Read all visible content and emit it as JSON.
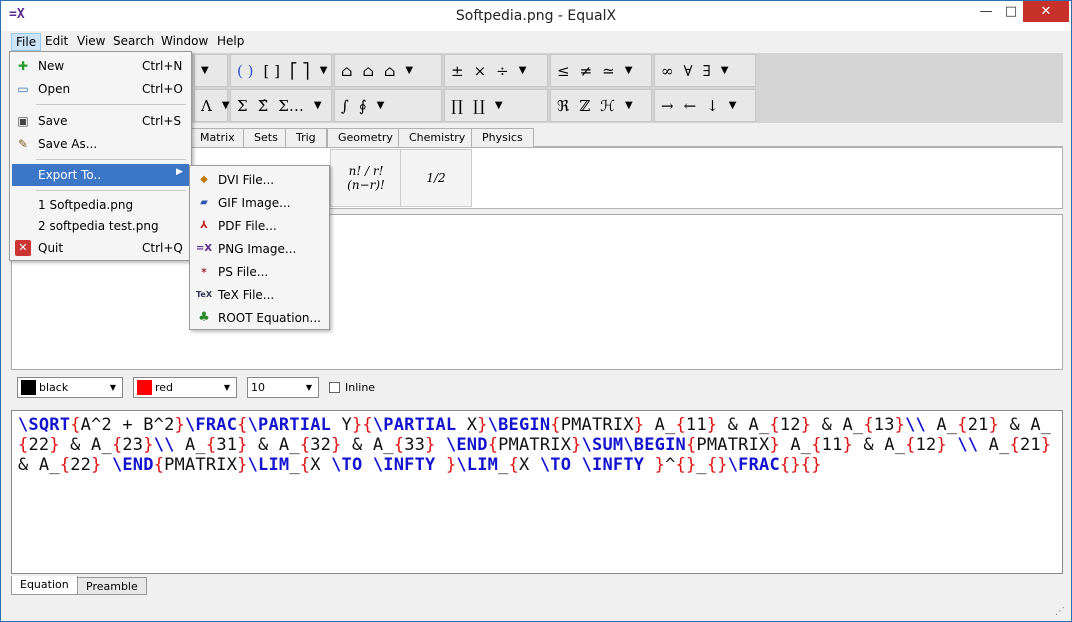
{
  "window": {
    "title": "Softpedia.png - EqualX",
    "app_icon": "=X"
  },
  "window_controls": {
    "minimize": "—",
    "maximize": "□",
    "close": "✕"
  },
  "menubar": [
    "File",
    "Edit",
    "View",
    "Search",
    "Window",
    "Help"
  ],
  "toolbar": {
    "row1": [
      [
        "( )",
        "[ ]",
        "⎡ ⎤"
      ],
      [
        "⌂",
        "⌂",
        "⌂"
      ],
      [
        "±",
        "×",
        "÷"
      ],
      [
        "≤",
        "≠",
        "≃"
      ],
      [
        "∞",
        "∀",
        "∃"
      ]
    ],
    "row2": [
      [
        "Λ"
      ],
      [
        "Σ",
        "Σ̂",
        "Σ…"
      ],
      [
        "∫",
        "∮"
      ],
      [
        "∏",
        "∐"
      ],
      [
        "ℜ",
        "ℤ",
        "ℋ"
      ],
      [
        "→",
        "←",
        "↓"
      ]
    ]
  },
  "tabs": [
    "Matrix",
    "Sets",
    "Trig",
    "Geometry",
    "Chemistry",
    "Physics"
  ],
  "palette": {
    "binomial": "n! / r!(n−r)!",
    "fraction": "1/2"
  },
  "options": {
    "text_color": "black",
    "text_color_hex": "#000000",
    "bg_color": "red",
    "bg_color_hex": "#ff0000",
    "font_size": "10",
    "inline_label": "Inline"
  },
  "editor": {
    "text": "\\SQRT{A^2 + B^2}\\FRAC{\\PARTIAL Y}{\\PARTIAL X}\\BEGIN{PMATRIX} A_{11} & A_{12} & A_{13}\\\\ A_{21} & A_{22} & A_{23}\\\\ A_{31} & A_{32} & A_{33} \\END{PMATRIX}\\SUM\\BEGIN{PMATRIX} A_{11} & A_{12} \\\\ A_{21} & A_{22} \\END{PMATRIX}\\LIM_{X \\TO \\INFTY }\\LIM_{X \\TO \\INFTY }^{}_{}\\FRAC{}{}"
  },
  "bottom_tabs": [
    "Equation",
    "Preamble"
  ],
  "file_menu": {
    "items": [
      {
        "label": "New",
        "shortcut": "Ctrl+N",
        "icon": "new-file-icon"
      },
      {
        "label": "Open",
        "shortcut": "Ctrl+O",
        "icon": "open-file-icon"
      },
      {
        "label": "Save",
        "shortcut": "Ctrl+S",
        "icon": "save-icon"
      },
      {
        "label": "Save As...",
        "shortcut": "",
        "icon": "save-as-icon"
      },
      {
        "label": "Export To..",
        "shortcut": "",
        "icon": ""
      },
      {
        "label": "1 Softpedia.png",
        "shortcut": "",
        "icon": ""
      },
      {
        "label": "2 softpedia test.png",
        "shortcut": "",
        "icon": ""
      },
      {
        "label": "Quit",
        "shortcut": "Ctrl+Q",
        "icon": "quit-icon"
      }
    ]
  },
  "export_menu": {
    "items": [
      {
        "label": "DVI File...",
        "icon": "dvi-icon"
      },
      {
        "label": "GIF Image...",
        "icon": "gif-icon"
      },
      {
        "label": "PDF File...",
        "icon": "pdf-icon"
      },
      {
        "label": "PNG Image...",
        "icon": "png-icon"
      },
      {
        "label": "PS File...",
        "icon": "ps-icon"
      },
      {
        "label": "TeX File...",
        "icon": "tex-icon"
      },
      {
        "label": "ROOT Equation...",
        "icon": "root-tree-icon"
      }
    ]
  }
}
